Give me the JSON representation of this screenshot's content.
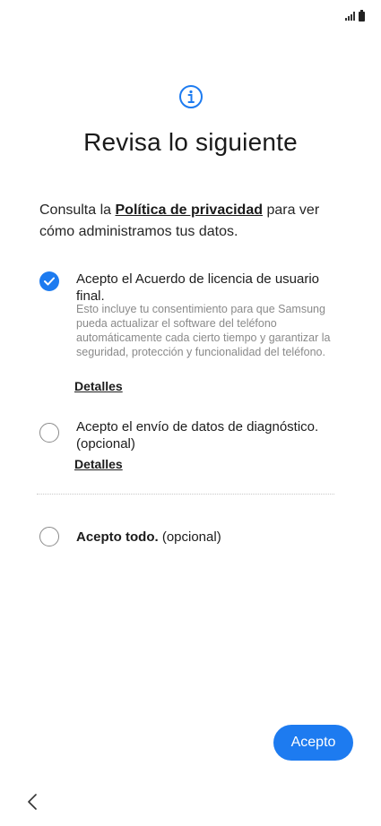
{
  "status_bar": {
    "icons": [
      "signal-icon",
      "battery-icon"
    ]
  },
  "header": {
    "icon": "info-icon",
    "title": "Revisa lo siguiente"
  },
  "intro": {
    "prefix": "Consulta la ",
    "link": "Política de privacidad",
    "suffix": " para ver cómo administramos tus datos."
  },
  "options": [
    {
      "label": "Acepto el Acuerdo de licencia de usuario final.",
      "description": "Esto incluye tu consentimiento para que Samsung pueda actualizar el software del teléfono automáticamente cada cierto tiempo y garantizar la seguridad, protección y funcionalidad del teléfono.",
      "details": "Detalles",
      "checked": true
    },
    {
      "label": "Acepto el envío de datos de diagnóstico. (opcional)",
      "details": "Detalles",
      "checked": false
    },
    {
      "label_bold": "Acepto todo.",
      "label_rest": " (opcional)",
      "checked": false
    }
  ],
  "actions": {
    "accept_label": "Acepto"
  },
  "nav": {
    "back_icon": "back-chevron-icon"
  },
  "colors": {
    "accent": "#1d7bf0",
    "text": "#1c1c1c",
    "muted": "#8a8a8a"
  }
}
